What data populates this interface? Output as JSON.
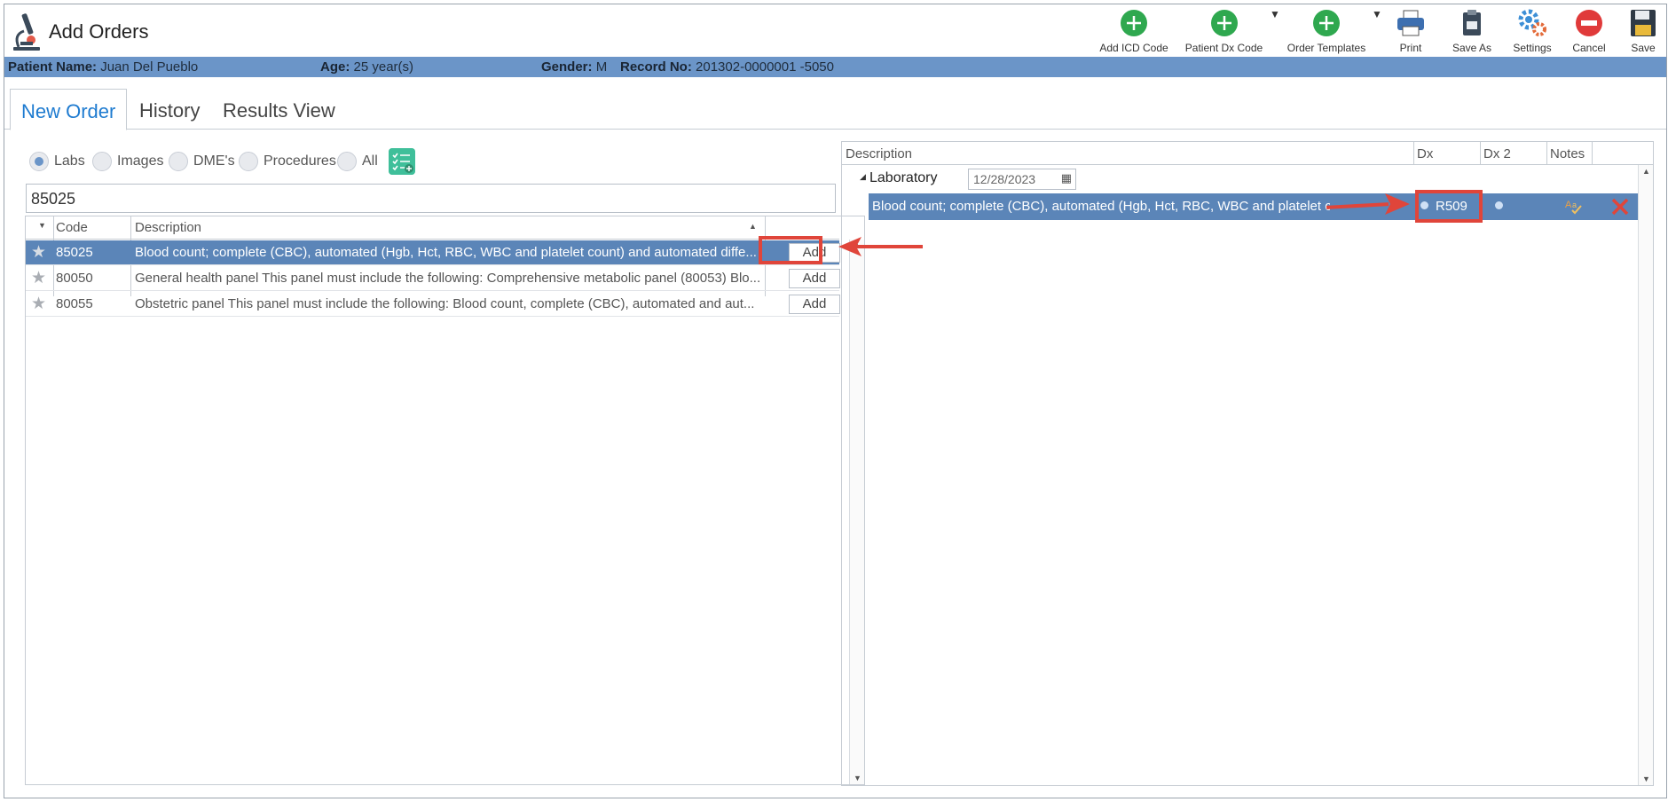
{
  "window": {
    "title": "Add Orders"
  },
  "toolbar": {
    "add_icd_code": "Add ICD Code",
    "patient_dx_code": "Patient Dx Code",
    "order_templates": "Order Templates",
    "print": "Print",
    "save_as": "Save As",
    "settings": "Settings",
    "cancel": "Cancel",
    "save": "Save"
  },
  "patient": {
    "name_label": "Patient Name:",
    "name": "Juan Del Pueblo",
    "age_label": "Age:",
    "age": "25 year(s)",
    "gender_label": "Gender:",
    "gender": "M",
    "record_label": "Record No:",
    "record": "201302-0000001 -5050"
  },
  "tabs": [
    {
      "label": "New Order",
      "active": true
    },
    {
      "label": "History",
      "active": false
    },
    {
      "label": "Results View",
      "active": false
    }
  ],
  "filters": {
    "options": [
      "Labs",
      "Images",
      "DME's",
      "Procedures",
      "All"
    ],
    "selected": "Labs"
  },
  "search": {
    "value": "85025"
  },
  "results_grid": {
    "headers": {
      "code": "Code",
      "description": "Description"
    },
    "add_label": "Add",
    "rows": [
      {
        "code": "85025",
        "description": "Blood count; complete (CBC), automated (Hgb, Hct, RBC, WBC and platelet count) and automated diffe...",
        "selected": true
      },
      {
        "code": "80050",
        "description": "General health panel This panel must include the following: Comprehensive metabolic panel (80053) Blo...",
        "selected": false
      },
      {
        "code": "80055",
        "description": "Obstetric panel This panel must include the following: Blood count, complete (CBC), automated and aut...",
        "selected": false
      }
    ]
  },
  "orders_grid": {
    "headers": {
      "description": "Description",
      "dx": "Dx",
      "dx2": "Dx 2",
      "notes": "Notes"
    },
    "group": {
      "label": "Laboratory",
      "date": "12/28/2023"
    },
    "order": {
      "description": "Blood count; complete (CBC), automated (Hgb, Hct, RBC, WBC and platelet count) and",
      "dx": "R509"
    }
  },
  "colors": {
    "accent": "#1e7bd0",
    "patient_bar": "#6b95c8",
    "selection": "#5b85b8",
    "annotation": "#e0453a"
  }
}
